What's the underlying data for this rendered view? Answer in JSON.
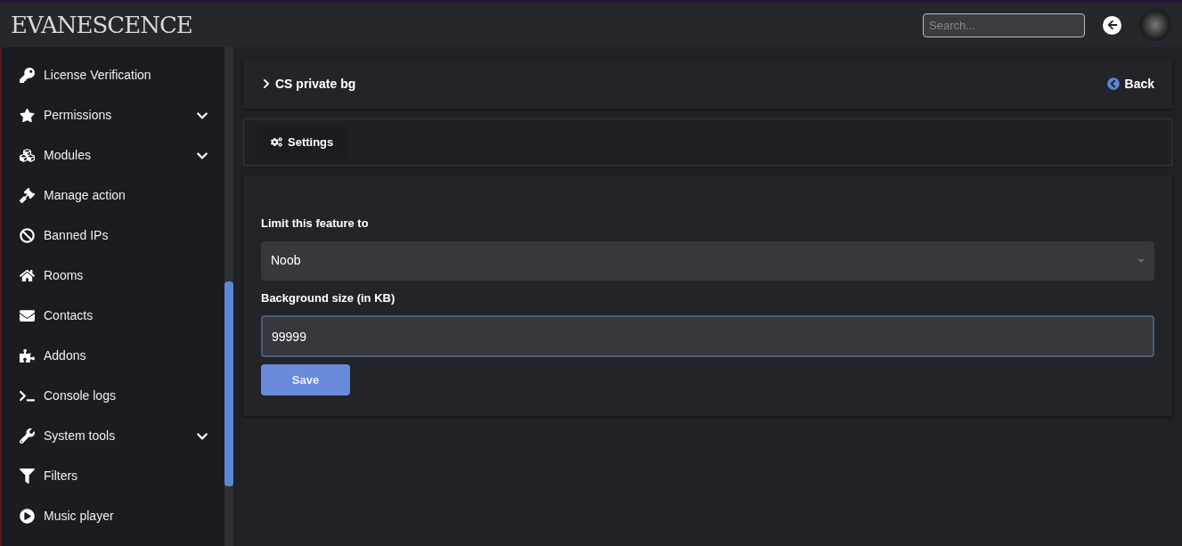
{
  "header": {
    "logo": "EVANESCENCE",
    "search": {
      "placeholder": "Search..."
    }
  },
  "sidebar": {
    "items": [
      {
        "label": "License Verification",
        "expandable": false
      },
      {
        "label": "Permissions",
        "expandable": true
      },
      {
        "label": "Modules",
        "expandable": true
      },
      {
        "label": "Manage action",
        "expandable": false
      },
      {
        "label": "Banned IPs",
        "expandable": false
      },
      {
        "label": "Rooms",
        "expandable": false
      },
      {
        "label": "Contacts",
        "expandable": false
      },
      {
        "label": "Addons",
        "expandable": false
      },
      {
        "label": "Console logs",
        "expandable": false
      },
      {
        "label": "System tools",
        "expandable": true
      },
      {
        "label": "Filters",
        "expandable": false
      },
      {
        "label": "Music player",
        "expandable": false
      }
    ]
  },
  "page": {
    "title": "CS private bg",
    "back": "Back"
  },
  "tabs": [
    {
      "label": "Settings",
      "selected": true
    }
  ],
  "form": {
    "fields": [
      {
        "kind": "select",
        "label": "Limit this feature to",
        "value": "Noob"
      },
      {
        "kind": "input",
        "label": "Background size (in KB)",
        "value": "99999"
      }
    ],
    "save": "Save"
  }
}
